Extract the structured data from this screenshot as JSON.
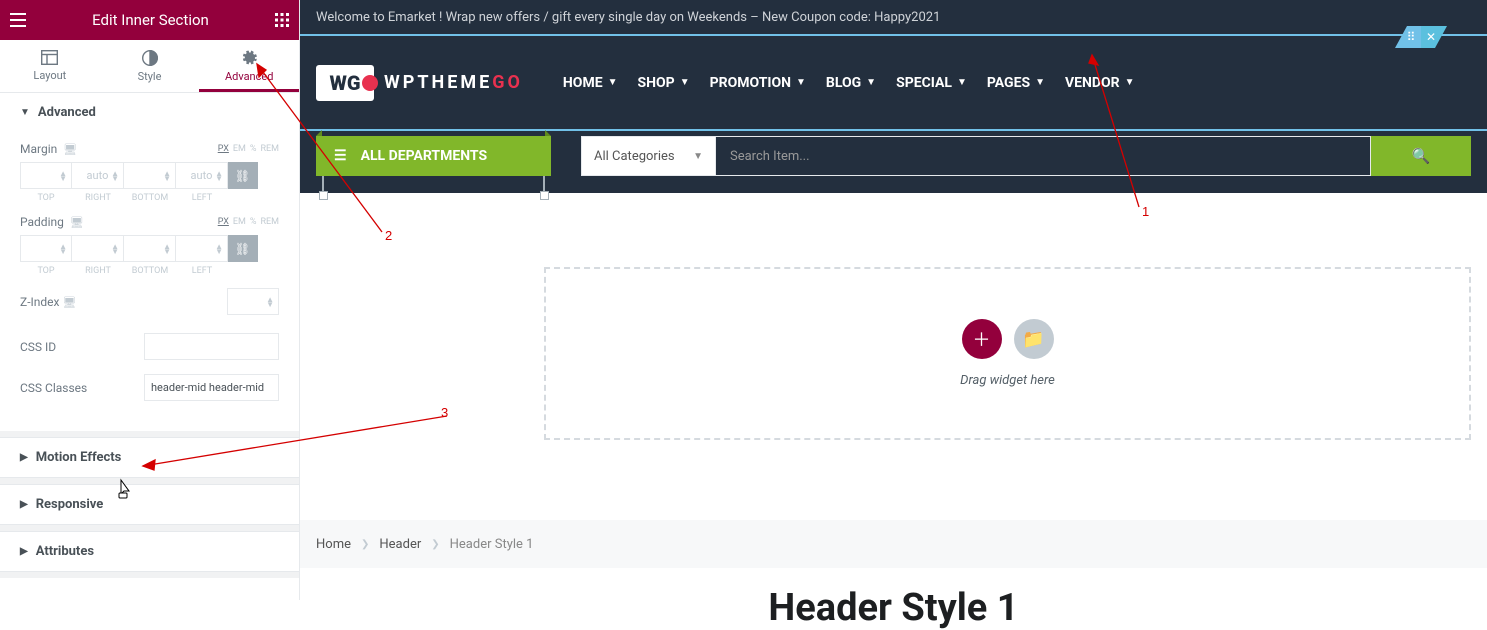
{
  "panel": {
    "title": "Edit Inner Section",
    "tabs": [
      {
        "id": "layout",
        "label": "Layout"
      },
      {
        "id": "style",
        "label": "Style"
      },
      {
        "id": "advanced",
        "label": "Advanced"
      }
    ],
    "active_tab": "advanced",
    "advanced": {
      "heading": "Advanced",
      "margin_label": "Margin",
      "padding_label": "Padding",
      "units": [
        "PX",
        "EM",
        "%",
        "REM"
      ],
      "dim_labels": [
        "TOP",
        "RIGHT",
        "BOTTOM",
        "LEFT"
      ],
      "auto_placeholder": "auto",
      "zindex_label": "Z-Index",
      "cssid_label": "CSS ID",
      "cssid_value": "",
      "cssclasses_label": "CSS Classes",
      "cssclasses_value": "header-mid header-mid"
    },
    "sections": [
      {
        "label": "Motion Effects"
      },
      {
        "label": "Responsive"
      },
      {
        "label": "Attributes"
      }
    ]
  },
  "preview": {
    "topbar": "Welcome to Emarket ! Wrap new offers / gift every single day on Weekends – New Coupon code: Happy2021",
    "logo_text": "WPTHEME",
    "logo_accent": "GO",
    "nav": [
      "HOME",
      "SHOP",
      "PROMOTION",
      "BLOG",
      "SPECIAL",
      "PAGES",
      "VENDOR"
    ],
    "departments": "ALL DEPARTMENTS",
    "cat_select": "All Categories",
    "search_placeholder": "Search Item...",
    "dropzone": "Drag widget here",
    "breadcrumbs": [
      "Home",
      "Header",
      "Header Style 1"
    ],
    "page_title": "Header Style 1"
  },
  "annotations": {
    "a1": "1",
    "a2": "2",
    "a3": "3"
  }
}
